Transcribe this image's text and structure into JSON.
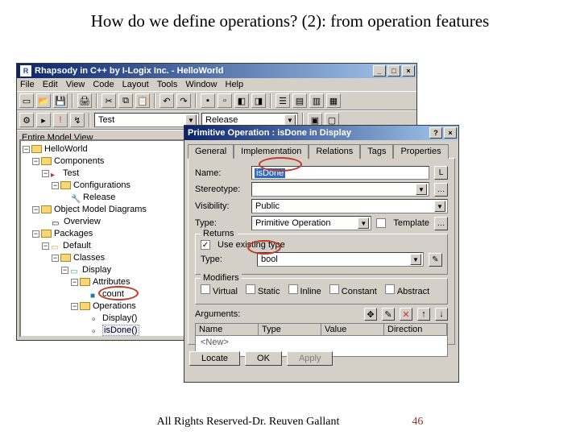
{
  "slide": {
    "title": "How do we define operations? (2): from operation features",
    "footer": "All Rights Reserved-Dr. Reuven Gallant",
    "page": "46"
  },
  "mainwin": {
    "title": "Rhapsody in C++ by I-Logix Inc. - HelloWorld",
    "menu": [
      "File",
      "Edit",
      "View",
      "Code",
      "Layout",
      "Tools",
      "Window",
      "Help"
    ],
    "combo1": "Test",
    "combo2": "Release",
    "tree_title": "Entire Model View"
  },
  "tree": [
    {
      "ind": 0,
      "exp": "-",
      "ico": "fld",
      "label": "HelloWorld"
    },
    {
      "ind": 1,
      "exp": "-",
      "ico": "fld",
      "label": "Components"
    },
    {
      "ind": 2,
      "exp": "-",
      "ico": "cmp",
      "label": "Test"
    },
    {
      "ind": 3,
      "exp": "-",
      "ico": "fld",
      "label": "Configurations"
    },
    {
      "ind": 4,
      "exp": "",
      "ico": "cfg",
      "label": "Release"
    },
    {
      "ind": 1,
      "exp": "-",
      "ico": "fld",
      "label": "Object Model Diagrams"
    },
    {
      "ind": 2,
      "exp": "",
      "ico": "omd",
      "label": "Overview"
    },
    {
      "ind": 1,
      "exp": "-",
      "ico": "fld",
      "label": "Packages"
    },
    {
      "ind": 2,
      "exp": "-",
      "ico": "pkg",
      "label": "Default"
    },
    {
      "ind": 3,
      "exp": "-",
      "ico": "fld",
      "label": "Classes"
    },
    {
      "ind": 4,
      "exp": "-",
      "ico": "cls",
      "label": "Display"
    },
    {
      "ind": 5,
      "exp": "-",
      "ico": "fld",
      "label": "Attributes"
    },
    {
      "ind": 6,
      "exp": "",
      "ico": "att",
      "label": "count"
    },
    {
      "ind": 5,
      "exp": "-",
      "ico": "fld",
      "label": "Operations"
    },
    {
      "ind": 6,
      "exp": "",
      "ico": "op",
      "label": "Display()"
    },
    {
      "ind": 6,
      "exp": "",
      "ico": "op",
      "label": "isDone()",
      "hl": true
    }
  ],
  "dialog": {
    "title": "Primitive Operation : isDone in Display",
    "tabs": [
      "General",
      "Implementation",
      "Relations",
      "Tags",
      "Properties"
    ],
    "name_lbl": "Name:",
    "name_val": "isDone",
    "stereo_lbl": "Stereotype:",
    "stereo_val": "",
    "vis_lbl": "Visibility:",
    "vis_val": "Public",
    "type_lbl": "Type:",
    "type_val": "Primitive Operation",
    "template_lbl": "Template",
    "returns_legend": "Returns",
    "use_existing": "Use existing type",
    "ret_type_lbl": "Type:",
    "ret_type_val": "bool",
    "modifiers_legend": "Modifiers",
    "mods": [
      "Virtual",
      "Static",
      "Inline",
      "Constant",
      "Abstract"
    ],
    "args_lbl": "Arguments:",
    "args_cols": [
      "Name",
      "Type",
      "Value",
      "Direction"
    ],
    "args_new": "<New>",
    "btn_locate": "Locate",
    "btn_ok": "OK",
    "btn_apply": "Apply"
  }
}
